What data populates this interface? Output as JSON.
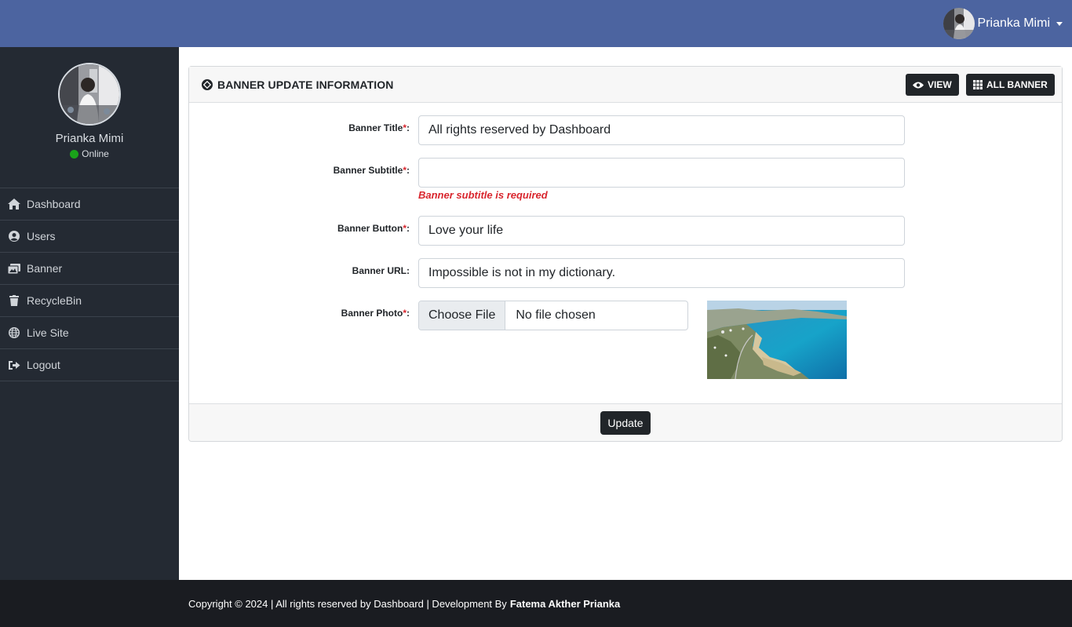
{
  "topbar": {
    "user_name": "Prianka Mimi",
    "avatar_icon": "user-photo-icon",
    "dropdown_icon": "caret-down-icon",
    "background": "#4c64a0"
  },
  "sidebar": {
    "profile": {
      "name": "Prianka Mimi",
      "status": "Online",
      "status_color": "#1aa31a"
    },
    "items": [
      {
        "label": "Dashboard",
        "icon": "home-icon"
      },
      {
        "label": "Users",
        "icon": "user-circle-icon"
      },
      {
        "label": "Banner",
        "icon": "images-icon"
      },
      {
        "label": "RecycleBin",
        "icon": "trash-icon"
      },
      {
        "label": "Live Site",
        "icon": "globe-icon"
      },
      {
        "label": "Logout",
        "icon": "sign-out-icon"
      }
    ]
  },
  "card": {
    "title": "BANNER UPDATE INFORMATION",
    "title_icon": "badge-icon",
    "view_button": "VIEW",
    "all_banner_button": "ALL BANNER",
    "update_button": "Update"
  },
  "form": {
    "required_mark": "*",
    "title": {
      "label": "Banner Title",
      "value": "All rights reserved by Dashboard"
    },
    "subtitle": {
      "label": "Banner Subtitle",
      "value": "",
      "error": "Banner subtitle is required"
    },
    "button": {
      "label": "Banner Button",
      "value": "Love your life"
    },
    "url": {
      "label": "Banner URL",
      "value": "Impossible is not in my dictionary."
    },
    "photo": {
      "label": "Banner Photo",
      "choose_label": "Choose File",
      "file_status": "No file chosen"
    }
  },
  "footer": {
    "text": "Copyright © 2024 | All rights reserved by Dashboard | Development By",
    "author": "Fatema Akther Prianka"
  }
}
